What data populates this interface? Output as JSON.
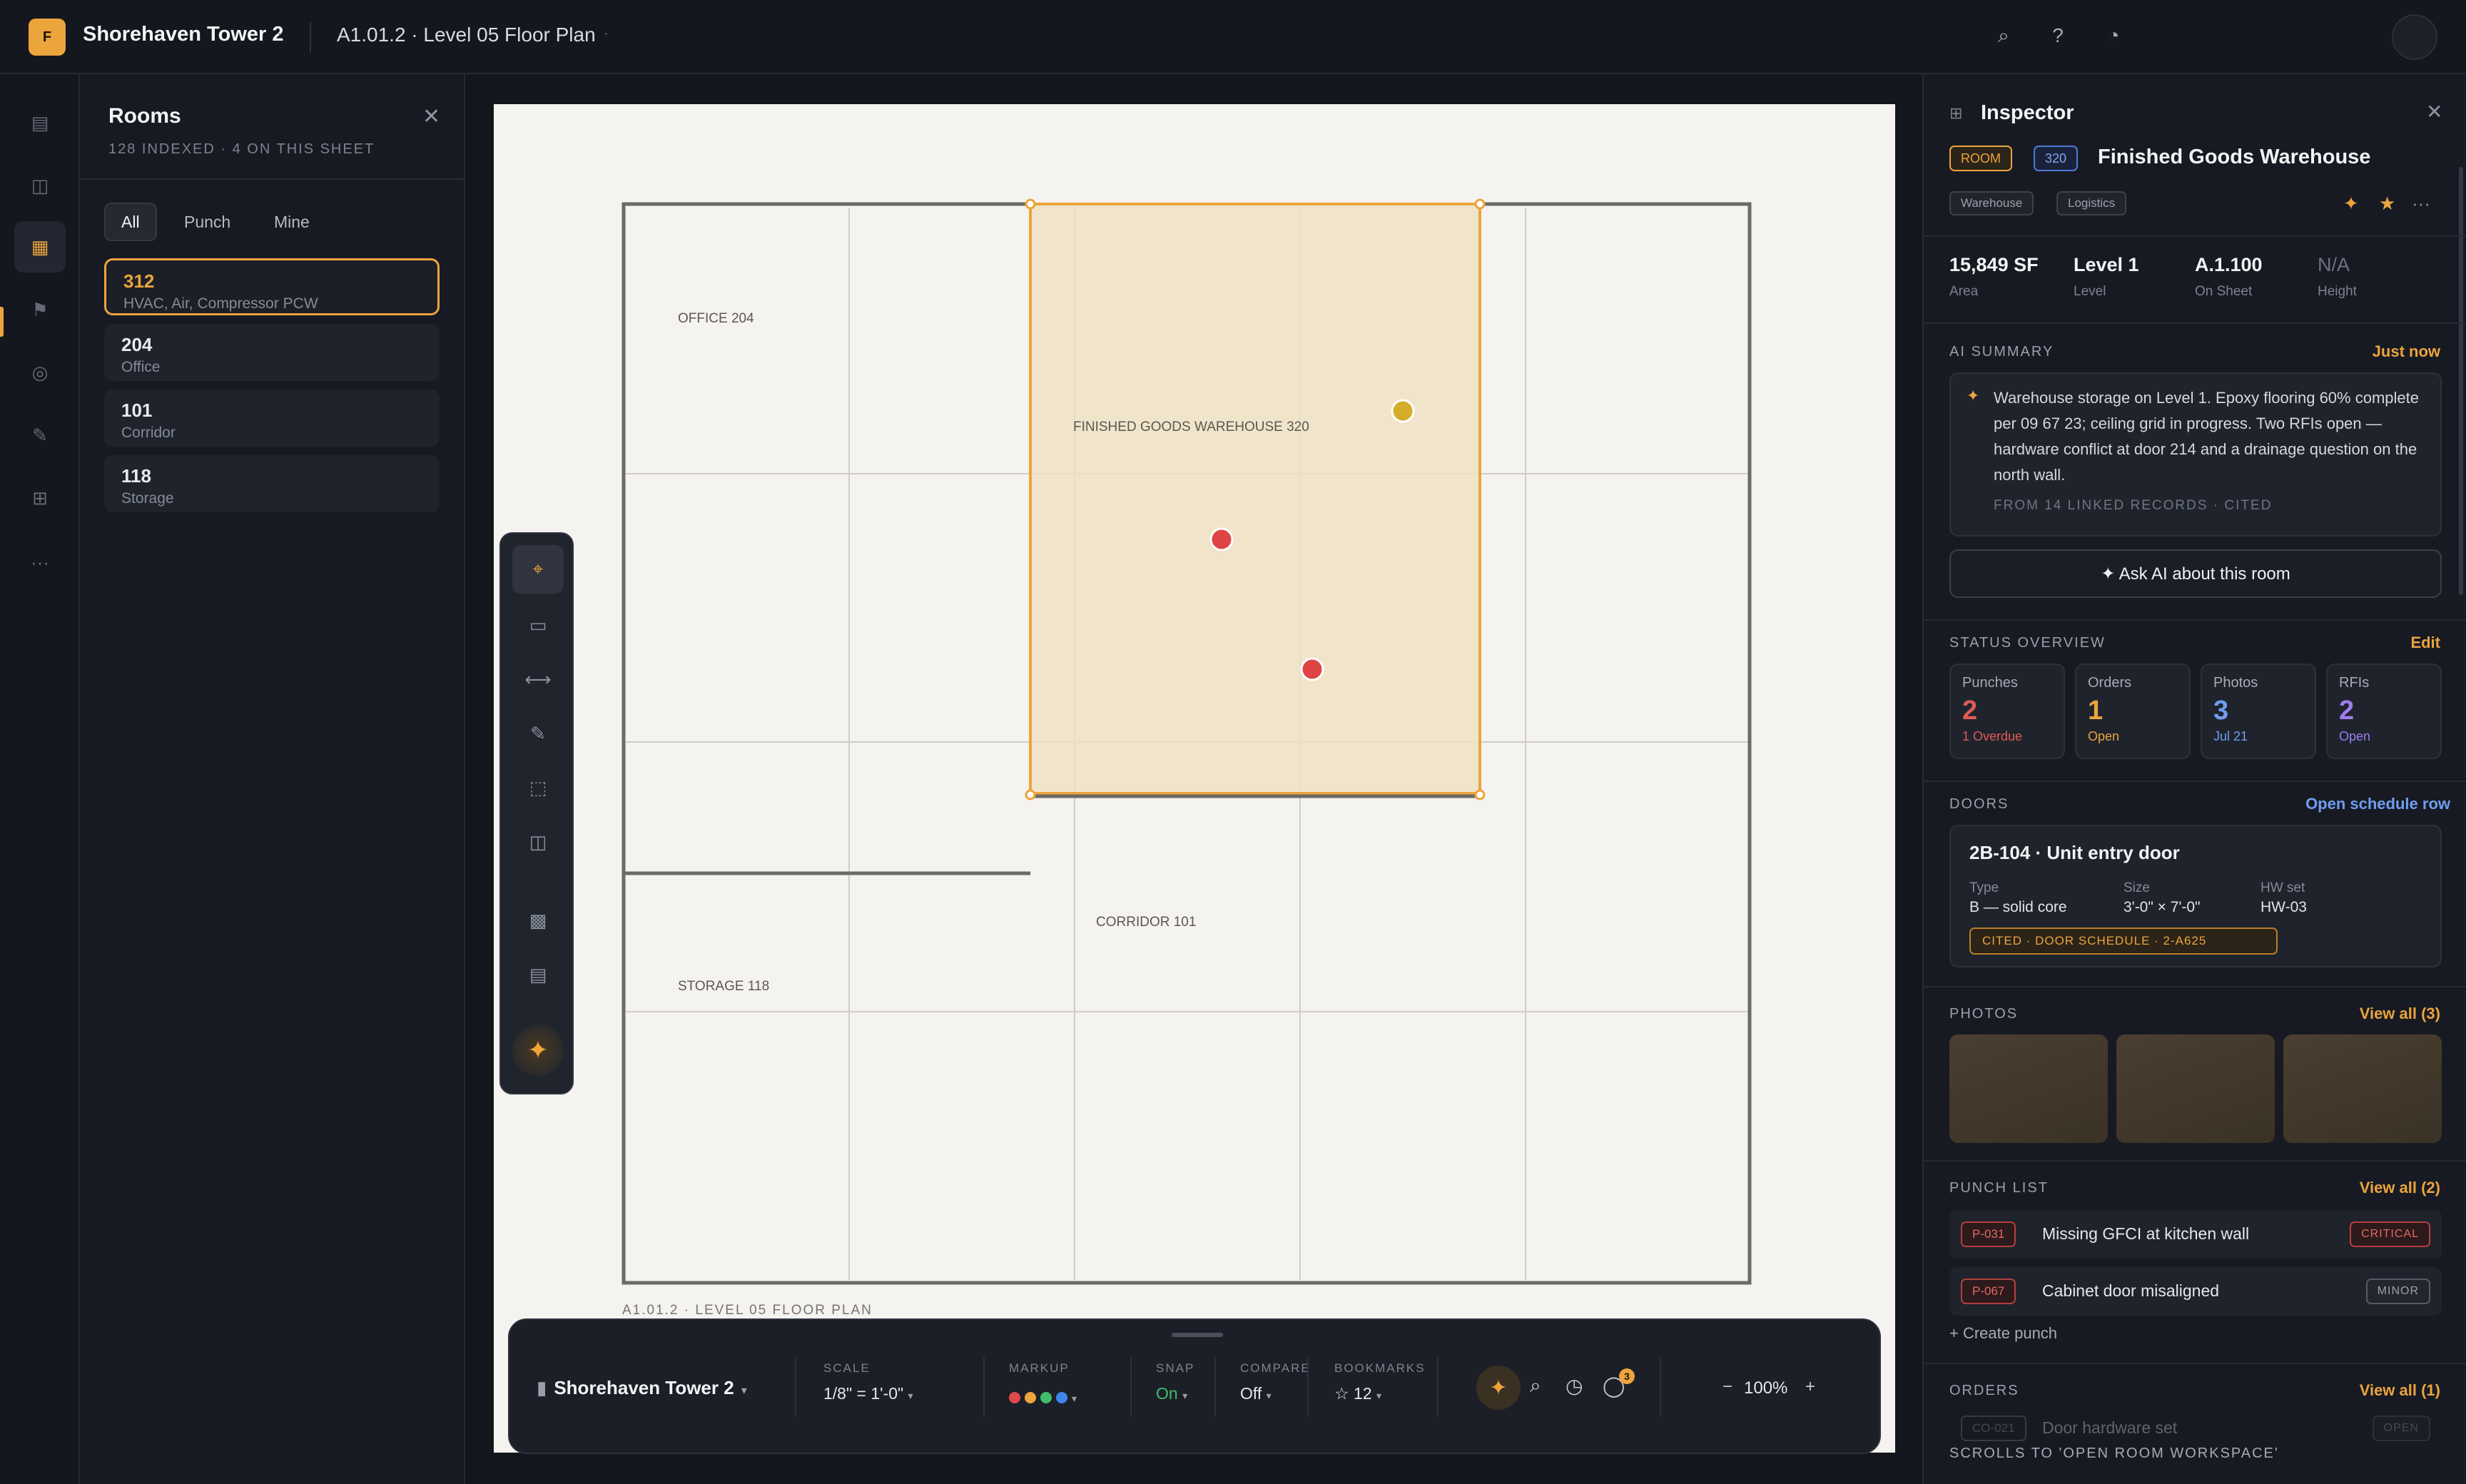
{
  "topbar": {
    "logo_letter": "F",
    "project": "Shorehaven Tower 2",
    "sheet": "A1.01.2 · Level 05 Floor Plan",
    "icons": [
      "search-icon",
      "help-icon",
      "theme-icon"
    ]
  },
  "rail": {
    "icons": [
      "list-icon",
      "panel-icon",
      "grid-icon",
      "flag-icon",
      "circle-icon",
      "pen-icon",
      "table-icon",
      "more-icon"
    ]
  },
  "rooms": {
    "title": "Rooms",
    "subtitle": "128 INDEXED · 4 ON THIS SHEET",
    "tabs": [
      "All",
      "Punch",
      "Mine"
    ],
    "items": [
      {
        "num": "312",
        "desc": "HVAC, Air, Compressor PCW"
      },
      {
        "num": "204",
        "desc": "Office"
      },
      {
        "num": "101",
        "desc": "Corridor"
      },
      {
        "num": "118",
        "desc": "Storage"
      }
    ]
  },
  "plan": {
    "labels": [
      "OFFICE 204",
      "FINISHED GOODS WAREHOUSE 320",
      "CORRIDOR 101",
      "STORAGE 118"
    ],
    "footer": "A1.01.2 · LEVEL 05 FLOOR PLAN",
    "pin_colors": {
      "yellow": "#d3ad2a",
      "red": "#de4444"
    }
  },
  "bottombar": {
    "project": "Shorehaven Tower 2",
    "scale_label": "SCALE",
    "scale_value": "1/8\" = 1'-0\"",
    "markup_label": "MARKUP",
    "markup_colors": [
      "#e04a4a",
      "#eca43d",
      "#3fbf6a",
      "#3f86ea"
    ],
    "snap_label": "SNAP",
    "snap_value": "On",
    "compare_label": "COMPARE",
    "compare_value": "Off",
    "bookmarks_label": "BOOKMARKS",
    "bookmarks_value": "12",
    "notifications": "3",
    "zoom": "100%"
  },
  "inspector": {
    "title": "Inspector",
    "chip_type": "ROOM",
    "chip_num": "320",
    "room_name": "Finished Goods Warehouse",
    "tags": [
      "Warehouse",
      "Logistics"
    ],
    "stats": [
      {
        "value": "15,849 SF",
        "label": "Area"
      },
      {
        "value": "Level 1",
        "label": "Level"
      },
      {
        "value": "A.1.100",
        "label": "On Sheet"
      },
      {
        "value": "N/A",
        "label": "Height"
      }
    ],
    "ai_title": "AI SUMMARY",
    "ai_time": "Just now",
    "ai_text": "Warehouse storage on Level 1. Epoxy flooring 60% complete per 09 67 23; ceiling grid in progress. Two RFIs open — hardware conflict at door 214 and a drainage question on the north wall.",
    "ai_source": "FROM 14 LINKED RECORDS · CITED",
    "ask_button": "✦ Ask AI about this room",
    "status_title": "STATUS OVERVIEW",
    "status_edit": "Edit",
    "status": [
      {
        "label": "Punches",
        "num": "2",
        "sub": "1 Overdue",
        "color": "#e05a55"
      },
      {
        "label": "Orders",
        "num": "1",
        "sub": "Open",
        "color": "#eca43d"
      },
      {
        "label": "Photos",
        "num": "3",
        "sub": "Jul 21",
        "color": "#6f9ef0"
      },
      {
        "label": "RFIs",
        "num": "2",
        "sub": "Open",
        "color": "#9d7ef0"
      }
    ],
    "doors_title": "DOORS",
    "doors_link": "Open schedule row",
    "door": {
      "title": "2B-104 · Unit entry door",
      "type_label": "Type",
      "type_value": "B — solid core",
      "size_label": "Size",
      "size_value": "3'-0\" × 7'-0\"",
      "hw_label": "HW set",
      "hw_value": "HW-03",
      "cited": "CITED · DOOR SCHEDULE · 2-A625"
    },
    "photos_title": "PHOTOS",
    "photos_link": "View all (3)",
    "punch_title": "PUNCH LIST",
    "punch_link": "View all (2)",
    "punches": [
      {
        "id": "P-031",
        "text": "Missing GFCI at kitchen wall",
        "sev": "CRITICAL"
      },
      {
        "id": "P-067",
        "text": "Cabinet door misaligned",
        "sev": "MINOR"
      }
    ],
    "create_punch": "+ Create punch",
    "orders_title": "ORDERS",
    "orders_link": "View all (1)",
    "order": {
      "id": "CO-021",
      "text": "Door hardware set",
      "status": "OPEN"
    },
    "scroll_hint": "SCROLLS TO 'OPEN ROOM WORKSPACE'"
  }
}
